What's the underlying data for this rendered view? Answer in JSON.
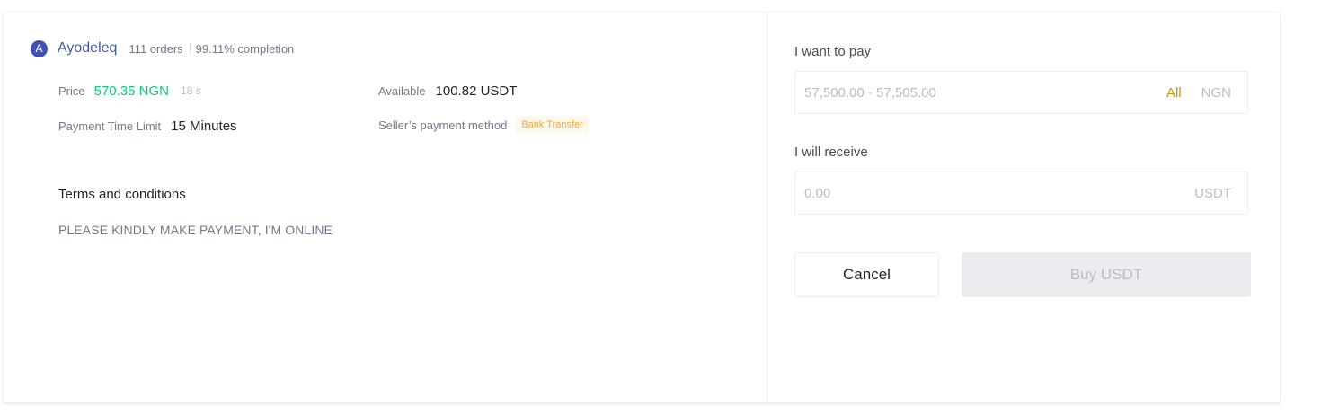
{
  "seller": {
    "avatar_letter": "A",
    "name": "Ayodeleq",
    "orders": "111 orders",
    "completion": "99.11% completion"
  },
  "details": {
    "price_label": "Price",
    "price_value": "570.35 NGN",
    "timer": "18 s",
    "available_label": "Available",
    "available_value": "100.82 USDT",
    "time_limit_label": "Payment Time Limit",
    "time_limit_value": "15 Minutes",
    "payment_method_label": "Seller’s payment method",
    "payment_method_value": "Bank Transfer"
  },
  "terms": {
    "title": "Terms and conditions",
    "text": "PLEASE KINDLY MAKE PAYMENT, I'M ONLINE"
  },
  "pay": {
    "label": "I want to pay",
    "placeholder": "57,500.00 - 57,505.00",
    "value": "",
    "all_label": "All",
    "currency": "NGN"
  },
  "receive": {
    "label": "I will receive",
    "placeholder": "0.00",
    "value": "",
    "currency": "USDT"
  },
  "actions": {
    "cancel_label": "Cancel",
    "buy_label": "Buy USDT",
    "buy_disabled": true
  },
  "colors": {
    "price_green": "#0ecb81",
    "accent_yellow": "#c99400",
    "tag_orange": "#f0a838",
    "seller_blue": "#3e5c9a",
    "avatar_bg": "#3f51b5"
  }
}
